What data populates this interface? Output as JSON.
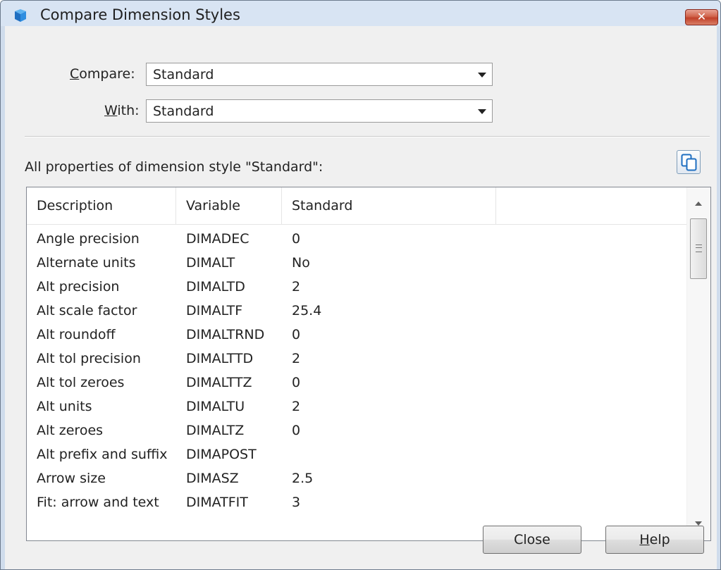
{
  "window": {
    "title": "Compare Dimension Styles",
    "close_symbol": "✕"
  },
  "compare": {
    "label_mnemonic": "C",
    "label_rest": "ompare:",
    "value": "Standard"
  },
  "with": {
    "label_mnemonic": "W",
    "label_rest": "ith:",
    "value": "Standard"
  },
  "properties_caption": "All properties of dimension style \"Standard\":",
  "copy_button_icon": "copy-to-clipboard-icon",
  "table": {
    "headers": [
      "Description",
      "Variable",
      "Standard",
      ""
    ],
    "rows": [
      {
        "description": "Angle precision",
        "variable": "DIMADEC",
        "standard": "0"
      },
      {
        "description": "Alternate units",
        "variable": "DIMALT",
        "standard": "No"
      },
      {
        "description": "Alt precision",
        "variable": "DIMALTD",
        "standard": "2"
      },
      {
        "description": "Alt scale factor",
        "variable": "DIMALTF",
        "standard": "25.4"
      },
      {
        "description": "Alt roundoff",
        "variable": "DIMALTRND",
        "standard": "0"
      },
      {
        "description": "Alt tol precision",
        "variable": "DIMALTTD",
        "standard": "2"
      },
      {
        "description": "Alt tol zeroes",
        "variable": "DIMALTTZ",
        "standard": "0"
      },
      {
        "description": "Alt units",
        "variable": "DIMALTU",
        "standard": "2"
      },
      {
        "description": "Alt zeroes",
        "variable": "DIMALTZ",
        "standard": "0"
      },
      {
        "description": "Alt prefix and suffix",
        "variable": "DIMAPOST",
        "standard": ""
      },
      {
        "description": "Arrow size",
        "variable": "DIMASZ",
        "standard": "2.5"
      },
      {
        "description": "Fit: arrow and text",
        "variable": "DIMATFIT",
        "standard": "3"
      }
    ]
  },
  "buttons": {
    "close_label": "Close",
    "help_mnemonic": "H",
    "help_rest": "elp"
  },
  "colors": {
    "titlebar": "#d8e4f3",
    "close_button": "#c1412a",
    "dialog_bg": "#f0f0f0"
  }
}
